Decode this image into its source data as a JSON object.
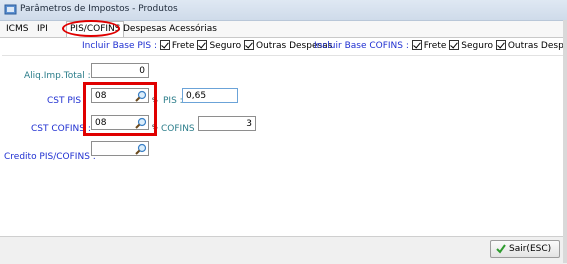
{
  "window": {
    "title": "Parâmetros de Impostos - Produtos"
  },
  "tabs": [
    {
      "label": "ICMS",
      "active": false
    },
    {
      "label": "IPI",
      "active": false
    },
    {
      "label": "PIS/COFINS",
      "active": true
    },
    {
      "label": "Despesas Acessórias",
      "active": false
    }
  ],
  "incluir_base_pis": {
    "label": "Incluir Base PIS :",
    "options": [
      {
        "label": "Frete",
        "checked": true
      },
      {
        "label": "Seguro",
        "checked": true
      },
      {
        "label": "Outras Despesas",
        "checked": true
      }
    ]
  },
  "incluir_base_cofins": {
    "label": "Incluir Base COFINS :",
    "options": [
      {
        "label": "Frete",
        "checked": true
      },
      {
        "label": "Seguro",
        "checked": true
      },
      {
        "label": "Outras Despesas",
        "checked": true
      }
    ]
  },
  "form": {
    "aliq_label": "Aliq.Imp.Total :",
    "aliq_value": "0",
    "cst_pis_label": "CST PIS :",
    "cst_pis_value": "08",
    "pis_pct_symbol": "%",
    "pis_label": "PIS :",
    "pis_value": "0,65",
    "cst_cofins_label": "CST COFINS :",
    "cst_cofins_value": "08",
    "cofins_pct_symbol": "%",
    "cofins_label": "COFINS :",
    "cofins_value": "3",
    "credito_label": "Credito PIS/COFINS :",
    "credito_value": ""
  },
  "footer": {
    "exit_label": "Sair(ESC)"
  },
  "colors": {
    "blue_label": "#1f2fd1",
    "teal_label": "#2b7d8a",
    "highlight": "#e00000"
  }
}
